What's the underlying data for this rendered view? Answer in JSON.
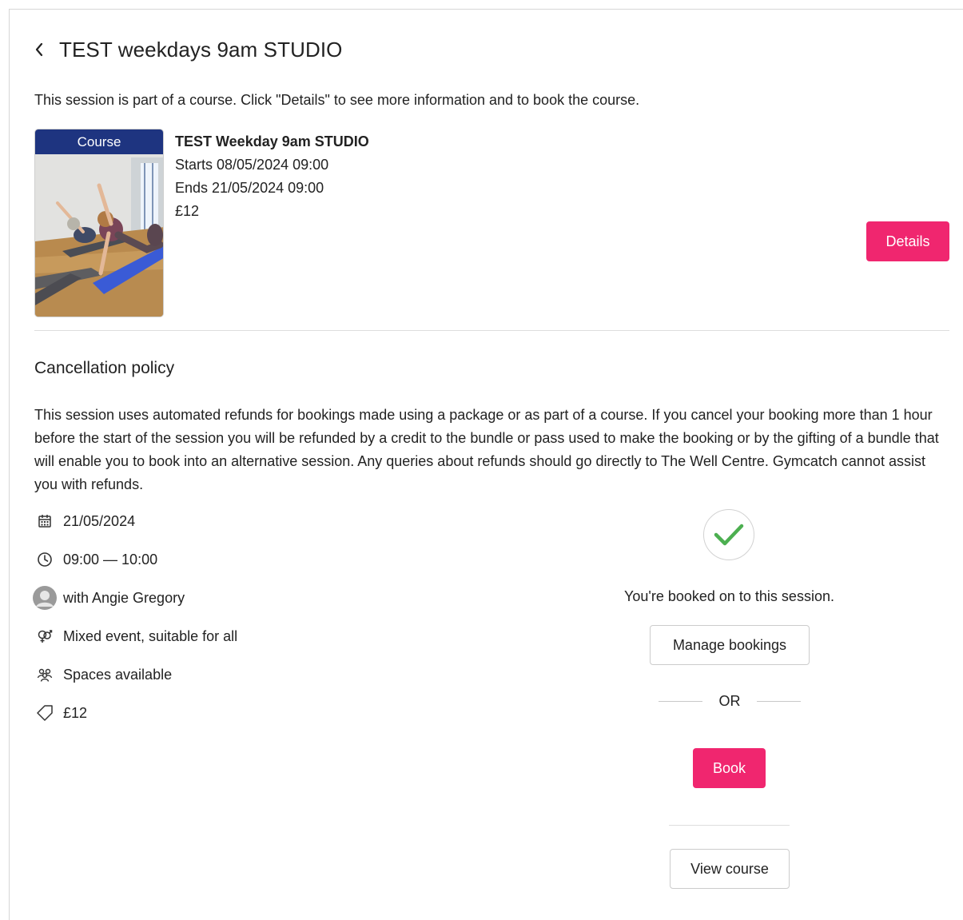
{
  "header": {
    "title": "TEST weekdays 9am STUDIO"
  },
  "course_note": "This session is part of a course. Click \"Details\" to see more information and to book the course.",
  "course_card": {
    "badge": "Course",
    "name": "TEST Weekday 9am STUDIO",
    "starts": "Starts 08/05/2024 09:00",
    "ends": "Ends 21/05/2024 09:00",
    "price": "£12",
    "details_label": "Details"
  },
  "cancellation": {
    "title": "Cancellation policy",
    "text": "This session uses automated refunds for bookings made using a package or as part of a course. If you cancel your booking more than 1 hour before the start of the session you will be refunded by a credit to the bundle or pass used to make the booking or by the gifting of a bundle that will enable you to book into an alternative session. Any queries about refunds should go directly to The Well Centre. Gymcatch cannot assist you with refunds."
  },
  "session": {
    "date": "21/05/2024",
    "time": "09:00 — 10:00",
    "instructor": "with Angie Gregory",
    "audience": "Mixed event, suitable for all",
    "availability": "Spaces available",
    "price": "£12"
  },
  "booking": {
    "status_text": "You're booked on to this session.",
    "manage_label": "Manage bookings",
    "or_label": "OR",
    "book_label": "Book",
    "view_course_label": "View course"
  },
  "colors": {
    "accent": "#f0266f",
    "badge": "#1e3480",
    "check": "#4caf50"
  },
  "icons": {
    "back": "chevron-left-icon",
    "date": "calendar-icon",
    "time": "clock-icon",
    "instructor": "avatar",
    "audience": "gender-icon",
    "availability": "people-icon",
    "price": "tag-icon",
    "status": "checkmark-icon"
  }
}
